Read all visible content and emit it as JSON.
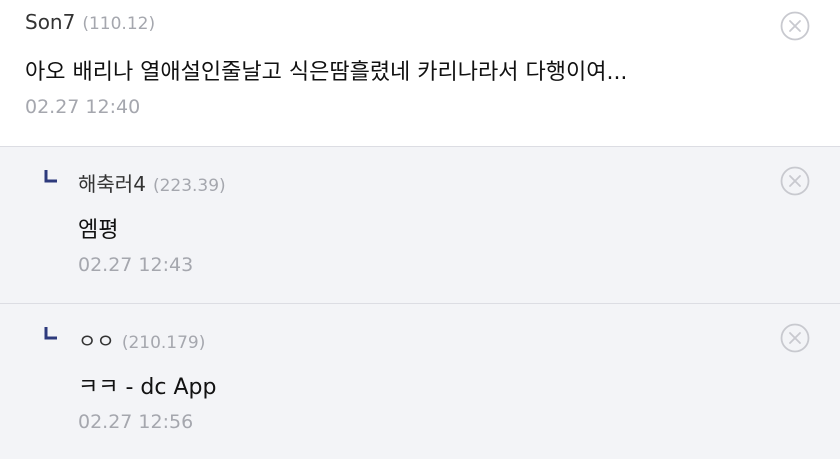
{
  "comments": [
    {
      "nick": "Son7",
      "ip": "(110.12)",
      "text": "아오 배리나 열애설인줄날고 식은땀흘렸네 카리나라서 다행이여...",
      "date": "02.27 12:40",
      "delete_icon": "close-circle-icon"
    },
    {
      "nick": "해축러4",
      "ip": "(223.39)",
      "text": "엠평",
      "date": "02.27 12:43",
      "reply_icon": "reply-arrow-icon",
      "delete_icon": "close-circle-icon"
    },
    {
      "nick": "ㅇㅇ",
      "ip": "(210.179)",
      "text": "ㅋㅋ - dc App",
      "date": "02.27 12:56",
      "reply_icon": "reply-arrow-icon",
      "delete_icon": "close-circle-icon"
    }
  ],
  "colors": {
    "accent_reply_arrow": "#2d3a7c",
    "separator": "#dcdde3",
    "reply_bg": "#f3f4f7",
    "meta_text": "#a5a7ae"
  }
}
